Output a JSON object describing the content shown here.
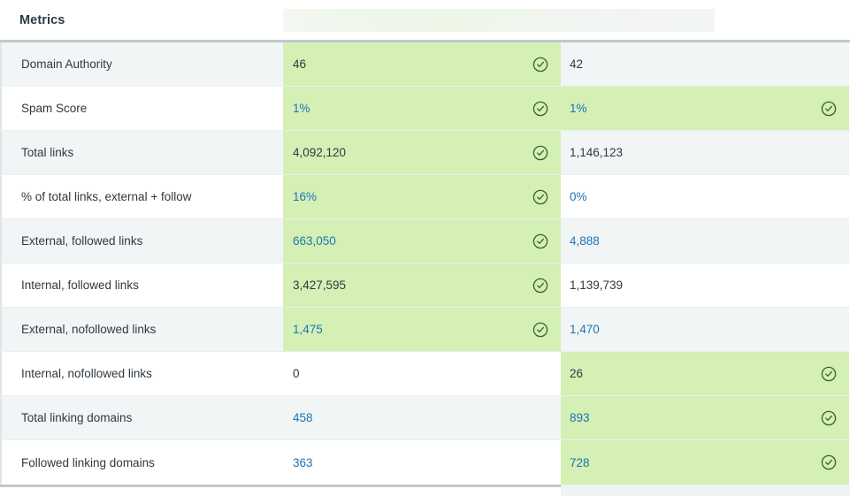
{
  "header": {
    "metrics_label": "Metrics",
    "placeholder_bar": "loading-placeholder"
  },
  "colors": {
    "win_highlight": "#d4f0b4",
    "stripe": "#f1f5f5",
    "link_text": "#1f73b7",
    "body_text": "#2f3941",
    "check_icon": "#37642b",
    "border": "#c2c8cc"
  },
  "icons": {
    "check_circle": "check-circle-icon"
  },
  "table": {
    "rows": [
      {
        "metric": "Domain Authority",
        "col1": {
          "value": "46",
          "link": false,
          "win": true,
          "check": true
        },
        "col2": {
          "value": "42",
          "link": false,
          "win": false,
          "check": false
        }
      },
      {
        "metric": "Spam Score",
        "col1": {
          "value": "1%",
          "link": true,
          "win": true,
          "check": true
        },
        "col2": {
          "value": "1%",
          "link": true,
          "win": true,
          "check": true
        }
      },
      {
        "metric": "Total links",
        "col1": {
          "value": "4,092,120",
          "link": false,
          "win": true,
          "check": true
        },
        "col2": {
          "value": "1,146,123",
          "link": false,
          "win": false,
          "check": false
        }
      },
      {
        "metric": "% of total links, external + follow",
        "col1": {
          "value": "16%",
          "link": true,
          "win": true,
          "check": true
        },
        "col2": {
          "value": "0%",
          "link": true,
          "win": false,
          "check": false
        }
      },
      {
        "metric": "External, followed links",
        "col1": {
          "value": "663,050",
          "link": true,
          "win": true,
          "check": true
        },
        "col2": {
          "value": "4,888",
          "link": true,
          "win": false,
          "check": false
        }
      },
      {
        "metric": "Internal, followed links",
        "col1": {
          "value": "3,427,595",
          "link": false,
          "win": true,
          "check": true
        },
        "col2": {
          "value": "1,139,739",
          "link": false,
          "win": false,
          "check": false
        }
      },
      {
        "metric": "External, nofollowed links",
        "col1": {
          "value": "1,475",
          "link": true,
          "win": true,
          "check": true
        },
        "col2": {
          "value": "1,470",
          "link": true,
          "win": false,
          "check": false
        }
      },
      {
        "metric": "Internal, nofollowed links",
        "col1": {
          "value": "0",
          "link": false,
          "win": false,
          "check": false
        },
        "col2": {
          "value": "26",
          "link": false,
          "win": true,
          "check": true
        }
      },
      {
        "metric": "Total linking domains",
        "col1": {
          "value": "458",
          "link": true,
          "win": false,
          "check": false
        },
        "col2": {
          "value": "893",
          "link": true,
          "win": true,
          "check": true
        }
      },
      {
        "metric": "Followed linking domains",
        "col1": {
          "value": "363",
          "link": true,
          "win": false,
          "check": false
        },
        "col2": {
          "value": "728",
          "link": true,
          "win": true,
          "check": true
        }
      }
    ]
  }
}
